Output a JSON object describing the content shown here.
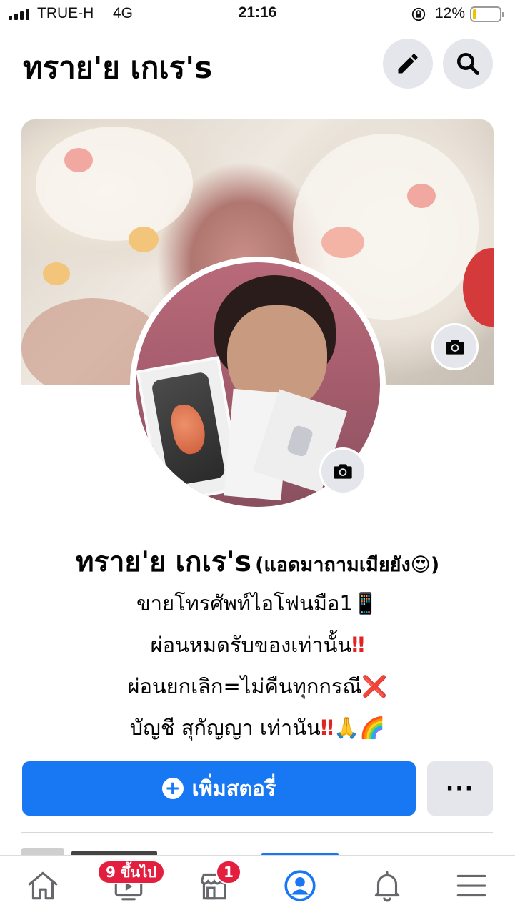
{
  "status_bar": {
    "carrier": "TRUE-H",
    "network": "4G",
    "time": "21:16",
    "battery_percent": "12%",
    "battery_level": 0.12
  },
  "header": {
    "title": "ทราย'ย เกเร's",
    "edit_icon": "pencil-icon",
    "search_icon": "search-icon"
  },
  "cover": {
    "camera_icon": "camera-icon"
  },
  "avatar": {
    "camera_icon": "camera-icon"
  },
  "profile": {
    "name": "ทราย'ย เกเร's",
    "alt_name": "(แอดมาถามเมียยัง😍)",
    "bio": [
      {
        "text": "ขายโทรศัพท์ไอโฟนมือ1",
        "emoji": "📱",
        "emoji_color": ""
      },
      {
        "text": "ผ่อนหมดรับของเท่านั้น",
        "emoji": "‼",
        "emoji_color": "#e02424"
      },
      {
        "text": "ผ่อนยกเลิก=ไม่คืนทุกกรณี",
        "emoji": "❌",
        "emoji_color": "#e02424"
      },
      {
        "text": "บัญชี สุกัญญา เท่านัน",
        "emoji": "‼🙏🌈",
        "emoji_color": "#e02424"
      }
    ]
  },
  "actions": {
    "add_story_label": "เพิ่มสตอรี่",
    "more_label": "···"
  },
  "tabbar": {
    "watch_badge": "9 ขึ้นไป",
    "marketplace_badge": "1",
    "active_tab": "profile",
    "accent": "#1877f2",
    "badge_color": "#e41e3f"
  }
}
